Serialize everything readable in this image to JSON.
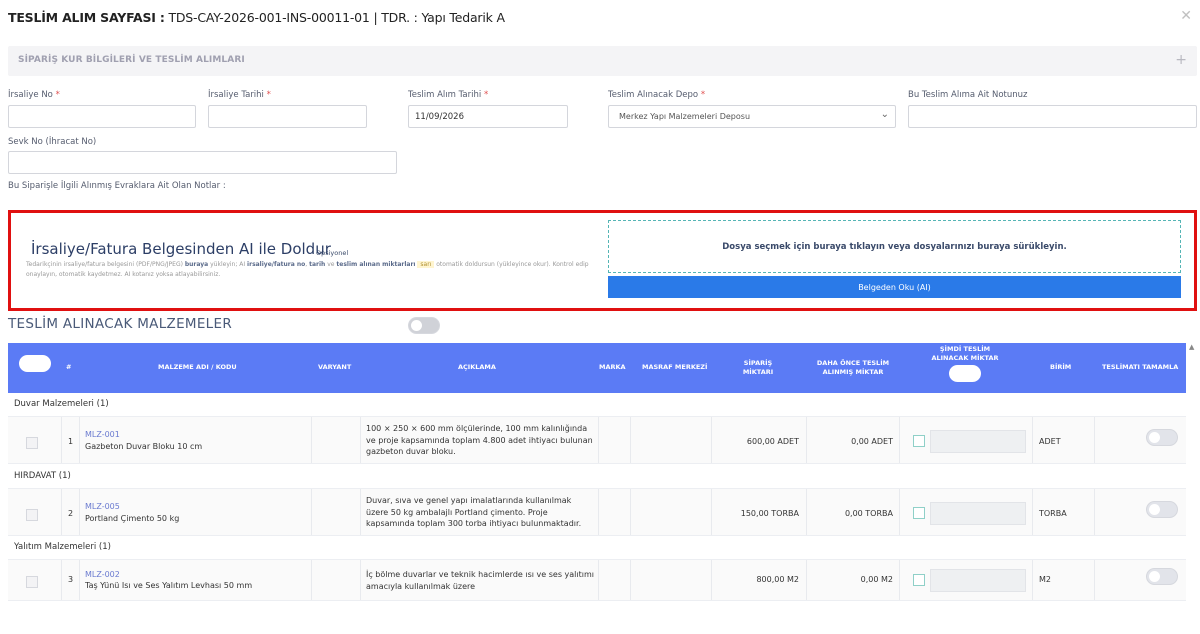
{
  "header": {
    "title_bold": "TESLİM ALIM SAYFASI :",
    "title_rest": " TDS-CAY-2026-001-INS-00011-01 | TDR. : Yapı Tedarik A"
  },
  "section": {
    "label": "SİPARİŞ KUR BİLGİLERİ VE TESLİM ALIMLARI",
    "plus": "+"
  },
  "form": {
    "irsaliye_no_label": "İrsaliye No",
    "irsaliye_tarihi_label": "İrsaliye Tarihi",
    "teslim_alim_tarihi_label": "Teslim Alım Tarihi",
    "teslim_alim_tarihi_value": "11/09/2026",
    "depo_label": "Teslim Alınacak Depo",
    "depo_value": "Merkez Yapı Malzemeleri Deposu",
    "not_label": "Bu Teslim Alıma Ait Notunuz",
    "sevk_label": "Sevk No (İhracat No)",
    "evrak_label": "Bu Siparişle İlgili Alınmış Evraklara Ait Olan Notlar :",
    "required_mark": "*"
  },
  "ai": {
    "title": "İrsaliye/Fatura Belgesinden AI ile Doldur",
    "optional": "Opsiyonel",
    "desc_1": "Tedarikçinin irsaliye/fatura belgesini (PDF/PNG/JPEG) ",
    "desc_b1": "buraya",
    "desc_2": " yükleyin; AI ",
    "desc_b2": "irsaliye/fatura no",
    "desc_3": ", ",
    "desc_b3": "tarih",
    "desc_4": " ve ",
    "desc_b4": "teslim alınan miktarları",
    "desc_hl": "sarı",
    "desc_5": " otomatik doldursun (yükleyince okur). Kontrol edip onaylayın, otomatik kaydetmez. AI kotanız yoksa atlayabilirsiniz.",
    "drop_text": "Dosya seçmek için buraya tıklayın veya dosyalarınızı buraya sürükleyin.",
    "read_button": "Belgeden Oku (AI)"
  },
  "materials_title": "TESLİM ALINACAK MALZEMELER",
  "table": {
    "headers": {
      "no": "#",
      "name": "MALZEME ADI / KODU",
      "variant": "VARYANT",
      "desc": "AÇIKLAMA",
      "brand": "MARKA",
      "cost_center": "MASRAF MERKEZİ",
      "order_qty_1": "SİPARİŞ",
      "order_qty_2": "MİKTARI",
      "prev_qty_1": "DAHA ÖNCE TESLİM",
      "prev_qty_2": "ALINMIŞ MİKTAR",
      "now_qty_1": "ŞİMDİ TESLİM",
      "now_qty_2": "ALINACAK MİKTAR",
      "unit": "BİRİM",
      "complete": "TESLİMATI TAMAMLA"
    },
    "groups": [
      {
        "name": "Duvar Malzemeleri (1)",
        "rows": [
          {
            "no": "1",
            "code": "MLZ-001",
            "name": "Gazbeton Duvar Bloku 10 cm",
            "desc": "100 × 250 × 600 mm ölçülerinde, 100 mm kalınlığında ve proje kapsamında toplam 4.800 adet ihtiyacı bulunan gazbeton duvar bloku.",
            "order_qty": "600,00  ADET",
            "prev_qty": "0,00  ADET",
            "unit": "ADET"
          }
        ]
      },
      {
        "name": "HIRDAVAT (1)",
        "rows": [
          {
            "no": "2",
            "code": "MLZ-005",
            "name": "Portland Çimento 50 kg",
            "desc": "Duvar, sıva ve genel yapı imalatlarında kullanılmak üzere 50 kg ambalajlı Portland çimento. Proje kapsamında toplam 300 torba ihtiyacı bulunmaktadır.",
            "order_qty": "150,00  TORBA",
            "prev_qty": "0,00  TORBA",
            "unit": "TORBA"
          }
        ]
      },
      {
        "name": "Yalıtım Malzemeleri (1)",
        "rows": [
          {
            "no": "3",
            "code": "MLZ-002",
            "name": "Taş Yünü Isı ve Ses Yalıtım Levhası 50 mm",
            "desc": "İç bölme duvarlar ve teknik hacimlerde ısı ve ses yalıtımı amacıyla kullanılmak üzere",
            "order_qty": "800,00  M2",
            "prev_qty": "0,00  M2",
            "unit": "M2"
          }
        ]
      }
    ]
  },
  "colors": {
    "header_blue": "#5b7bf5",
    "button_blue": "#2a7ae8",
    "highlight_red": "#e01010"
  }
}
